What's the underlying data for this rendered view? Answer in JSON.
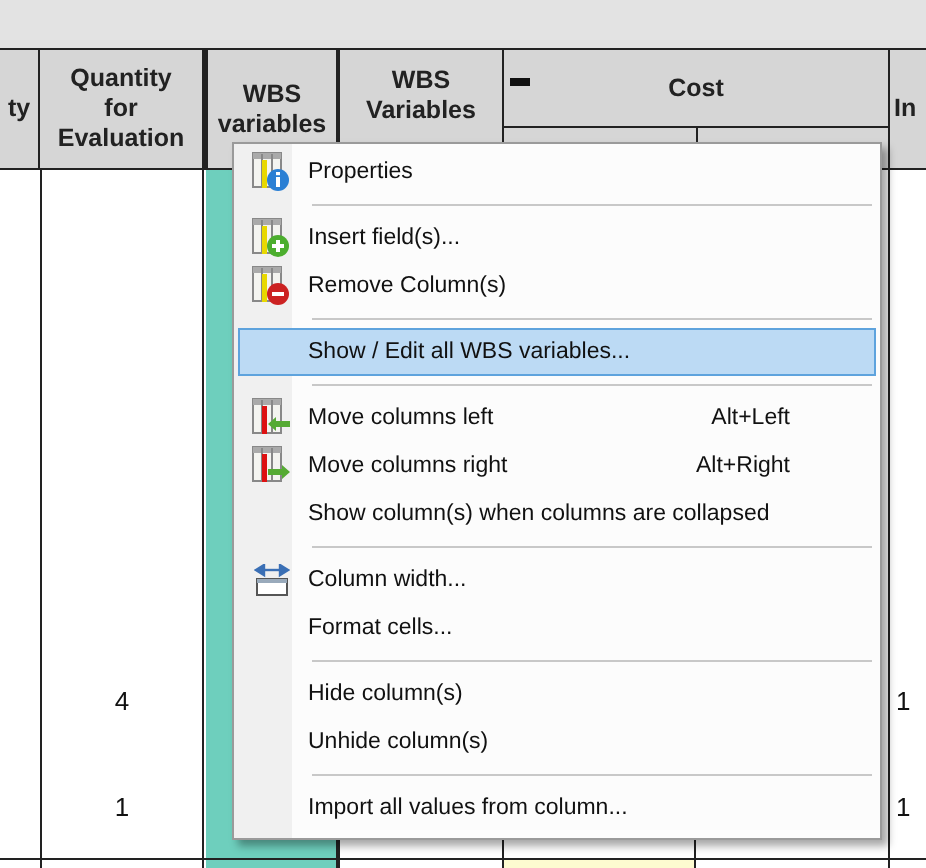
{
  "table": {
    "columns": [
      {
        "label": "ty",
        "selected": false
      },
      {
        "label": "Quantity for Evaluation",
        "selected": false
      },
      {
        "label": "WBS variables",
        "selected": true
      },
      {
        "label": "WBS Variables",
        "selected": false
      },
      {
        "label": "Cost",
        "selected": false
      },
      {
        "label": "In",
        "selected": false
      }
    ],
    "rows": [
      {
        "cells": [
          "",
          "4",
          "",
          "",
          "",
          "",
          "1"
        ],
        "highlighted": false
      },
      {
        "cells": [
          "",
          "1",
          "",
          "",
          "",
          "",
          "1"
        ],
        "highlighted": false
      },
      {
        "cells": [
          "",
          "",
          "",
          "",
          "",
          "",
          ""
        ],
        "highlighted": true
      }
    ]
  },
  "context_menu": {
    "items": [
      {
        "kind": "item",
        "label": "Properties",
        "selected": false
      },
      {
        "kind": "separator"
      },
      {
        "kind": "item",
        "label": "Insert field(s)...",
        "selected": false
      },
      {
        "kind": "item",
        "label": "Remove Column(s)",
        "selected": false
      },
      {
        "kind": "separator"
      },
      {
        "kind": "item",
        "label": "Show / Edit all WBS variables...",
        "selected": true
      },
      {
        "kind": "separator"
      },
      {
        "kind": "item",
        "label": "Move columns left",
        "shortcut": "Alt+Left",
        "selected": false
      },
      {
        "kind": "item",
        "label": "Move columns right",
        "shortcut": "Alt+Right",
        "selected": false
      },
      {
        "kind": "item",
        "label": "Show column(s) when columns are collapsed",
        "selected": false
      },
      {
        "kind": "separator"
      },
      {
        "kind": "item",
        "label": "Column width...",
        "selected": false
      },
      {
        "kind": "item",
        "label": "Format cells...",
        "selected": false
      },
      {
        "kind": "separator"
      },
      {
        "kind": "item",
        "label": "Hide column(s)",
        "selected": false
      },
      {
        "kind": "item",
        "label": "Unhide column(s)",
        "selected": false
      },
      {
        "kind": "separator"
      },
      {
        "kind": "item",
        "label": "Import all values from column...",
        "selected": false
      }
    ]
  }
}
